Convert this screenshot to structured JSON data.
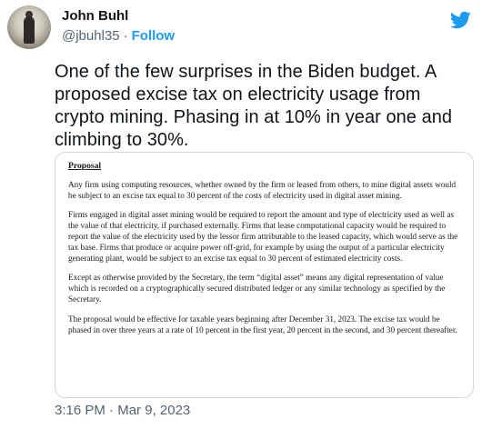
{
  "author": {
    "name": "John Buhl",
    "handle": "@jbuhl35",
    "separator": "·",
    "follow_label": "Follow"
  },
  "tweet": {
    "text": "One of the few surprises in the Biden budget. A proposed excise tax on electricity usage from crypto mining. Phasing in at 10% in year one and climbing to 30%.",
    "time": "3:16 PM",
    "separator": "·",
    "date": "Mar 9, 2023"
  },
  "document": {
    "heading": "Proposal",
    "paragraphs": [
      "Any firm using computing resources, whether owned by the firm or leased from others, to mine digital assets would be subject to an excise tax equal to 30 percent of  the costs of electricity used in digital asset mining.",
      "Firms engaged in digital asset mining would be required to report the amount and type of electricity used as well as the value of that electricity, if purchased externally. Firms that lease computational capacity would be required to report the value of the electricity used by the lessor firm attributable to the leased capacity, which would serve as the tax base. Firms that produce or acquire power off-grid, for example by using the output of a particular electricity generating plant, would be subject to an excise tax equal to 30 percent of estimated electricity costs.",
      "Except as otherwise provided by the Secretary, the term “digital asset” means any digital representation of value which is recorded on a cryptographically secured distributed ledger or any similar technology as specified by the Secretary.",
      "The proposal would be effective for taxable years beginning after December 31, 2023. The excise tax would be phased in over three years at a rate of 10 percent in the first year, 20 percent in the second, and 30 percent thereafter."
    ]
  },
  "icons": {
    "brand": "twitter-bird-icon",
    "brand_color": "#1d9bf0"
  }
}
